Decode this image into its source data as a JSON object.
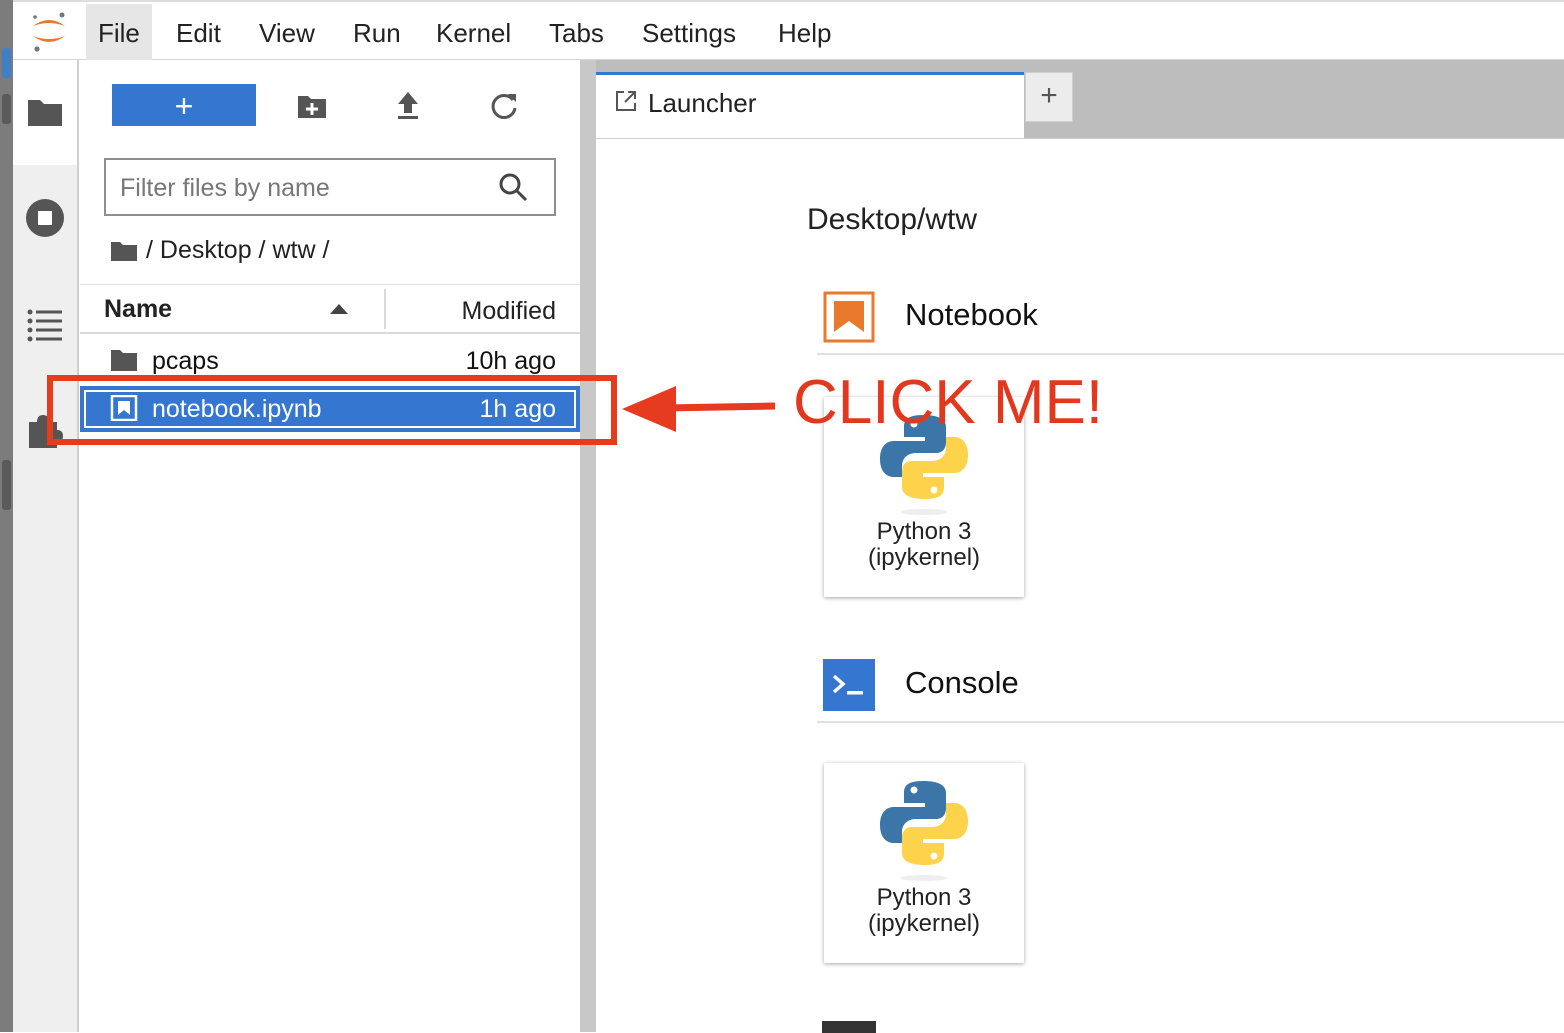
{
  "menubar": {
    "items": [
      {
        "label": "File"
      },
      {
        "label": "Edit"
      },
      {
        "label": "View"
      },
      {
        "label": "Run"
      },
      {
        "label": "Kernel"
      },
      {
        "label": "Tabs"
      },
      {
        "label": "Settings"
      },
      {
        "label": "Help"
      }
    ]
  },
  "activity_bar": {
    "items": [
      {
        "icon": "folder-icon",
        "selected": true
      },
      {
        "icon": "stop-circle-icon"
      },
      {
        "icon": "list-icon"
      },
      {
        "icon": "puzzle-icon"
      }
    ]
  },
  "file_browser": {
    "toolbar": {
      "new_launcher_label": "+",
      "buttons": [
        "new-folder-icon",
        "upload-icon",
        "refresh-icon"
      ]
    },
    "filter": {
      "placeholder": "Filter files by name",
      "value": ""
    },
    "breadcrumb": "/ Desktop / wtw /",
    "columns": {
      "name": "Name",
      "modified": "Modified",
      "sort": "ascending"
    },
    "files": [
      {
        "name": "pcaps",
        "modified": "10h ago",
        "type": "folder",
        "selected": false
      },
      {
        "name": "notebook.ipynb",
        "modified": "1h ago",
        "type": "notebook",
        "selected": true
      }
    ]
  },
  "tabs": {
    "active": {
      "label": "Launcher",
      "icon": "launcher-icon"
    },
    "add_label": "+"
  },
  "launcher": {
    "cwd": "Desktop/wtw",
    "sections": [
      {
        "title": "Notebook",
        "icon": "notebook-icon",
        "color": "#e87a2e",
        "cards": [
          {
            "line1": "Python 3",
            "line2": "(ipykernel)"
          }
        ]
      },
      {
        "title": "Console",
        "icon": "console-icon",
        "color": "#3476d0",
        "cards": [
          {
            "line1": "Python 3",
            "line2": "(ipykernel)"
          }
        ]
      }
    ]
  },
  "annotation": {
    "text": "CLICK ME!",
    "color": "#e3371e"
  },
  "colors": {
    "accent": "#3476d0",
    "notebook_orange": "#e87a2e",
    "annotation_red": "#e3371e"
  }
}
